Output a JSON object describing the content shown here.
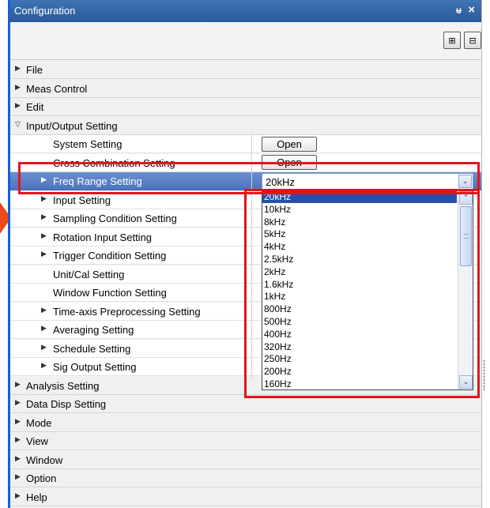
{
  "window": {
    "title": "Configuration",
    "pin_glyph": "ᵾ",
    "close_glyph": "×"
  },
  "toolbar": {
    "icons": [
      "expand-all-icon",
      "collapse-all-icon"
    ],
    "btn1_glyph": "⊞",
    "btn2_glyph": "⊟"
  },
  "tree": {
    "top_items": [
      {
        "label": "File",
        "expanded": false
      },
      {
        "label": "Meas Control",
        "expanded": false
      },
      {
        "label": "Edit",
        "expanded": false
      },
      {
        "label": "Input/Output Setting",
        "expanded": true
      }
    ],
    "io_children": [
      {
        "label": "System Setting",
        "has_arrow": false,
        "button": "Open"
      },
      {
        "label": "Cross Combination Setting",
        "has_arrow": false,
        "button": "Open"
      },
      {
        "label": "Freq Range Setting",
        "has_arrow": true,
        "selected": true
      },
      {
        "label": "Input Setting",
        "has_arrow": true
      },
      {
        "label": "Sampling Condition Setting",
        "has_arrow": true
      },
      {
        "label": "Rotation Input Setting",
        "has_arrow": true
      },
      {
        "label": "Trigger Condition Setting",
        "has_arrow": true
      },
      {
        "label": "Unit/Cal Setting",
        "has_arrow": false
      },
      {
        "label": "Window Function Setting",
        "has_arrow": false
      },
      {
        "label": "Time-axis Preprocessing Setting",
        "has_arrow": true
      },
      {
        "label": "Averaging Setting",
        "has_arrow": true
      },
      {
        "label": "Schedule Setting",
        "has_arrow": true
      },
      {
        "label": "Sig Output Setting",
        "has_arrow": true
      }
    ],
    "bottom_items": [
      {
        "label": "Analysis Setting"
      },
      {
        "label": "Data Disp Setting"
      },
      {
        "label": "Mode"
      },
      {
        "label": "View"
      },
      {
        "label": "Window"
      },
      {
        "label": "Option"
      },
      {
        "label": "Help"
      }
    ]
  },
  "freq_combo": {
    "value": "20kHz",
    "options": [
      "20kHz",
      "10kHz",
      "8kHz",
      "5kHz",
      "4kHz",
      "2.5kHz",
      "2kHz",
      "1.6kHz",
      "1kHz",
      "800Hz",
      "500Hz",
      "400Hz",
      "320Hz",
      "250Hz",
      "200Hz",
      "160Hz"
    ],
    "selected_index": 0
  },
  "glyphs": {
    "collapsed": "▶",
    "expanded": "▽",
    "scroll_down": "⌄",
    "scroll_up": "⌃"
  },
  "colors": {
    "title_bar": "#2f64a8",
    "selection": "#4d74bb",
    "highlight": "#e0161e",
    "accent_left": "#1560d8"
  }
}
